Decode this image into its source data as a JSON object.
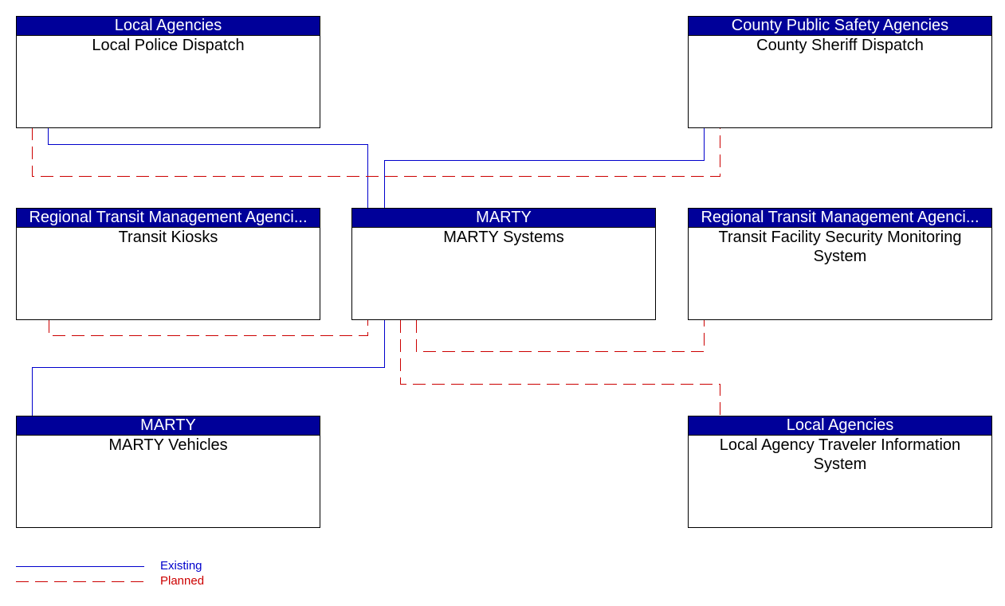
{
  "elements": [
    {
      "stakeholder": "Local Agencies",
      "name": "Local Police Dispatch"
    },
    {
      "stakeholder": "County Public Safety Agencies",
      "name": "County Sheriff Dispatch"
    },
    {
      "stakeholder": "Regional Transit Management Agenci...",
      "name": "Transit Kiosks"
    },
    {
      "stakeholder": "MARTY",
      "name": "MARTY Systems"
    },
    {
      "stakeholder": "Regional Transit Management Agenci...",
      "name": "Transit Facility Security Monitoring System"
    },
    {
      "stakeholder": "MARTY",
      "name": "MARTY Vehicles"
    },
    {
      "stakeholder": "Local Agencies",
      "name": "Local Agency Traveler Information System"
    }
  ],
  "connections": [
    {
      "from": "Local Police Dispatch",
      "to": "MARTY Systems",
      "status": "existing"
    },
    {
      "from": "County Sheriff Dispatch",
      "to": "MARTY Systems",
      "status": "existing"
    },
    {
      "from": "Local Police Dispatch",
      "to": "County Sheriff Dispatch",
      "status": "planned"
    },
    {
      "from": "Transit Kiosks",
      "to": "MARTY Systems",
      "status": "planned"
    },
    {
      "from": "MARTY Systems",
      "to": "MARTY Vehicles",
      "status": "existing"
    },
    {
      "from": "MARTY Systems",
      "to": "Transit Facility Security Monitoring System",
      "status": "planned"
    },
    {
      "from": "MARTY Systems",
      "to": "Local Agency Traveler Information System",
      "status": "planned"
    }
  ],
  "legend": {
    "existing": "Existing",
    "planned": "Planned"
  },
  "colors": {
    "existing": "#0000cc",
    "planned": "#cc0000",
    "header": "#000099"
  }
}
